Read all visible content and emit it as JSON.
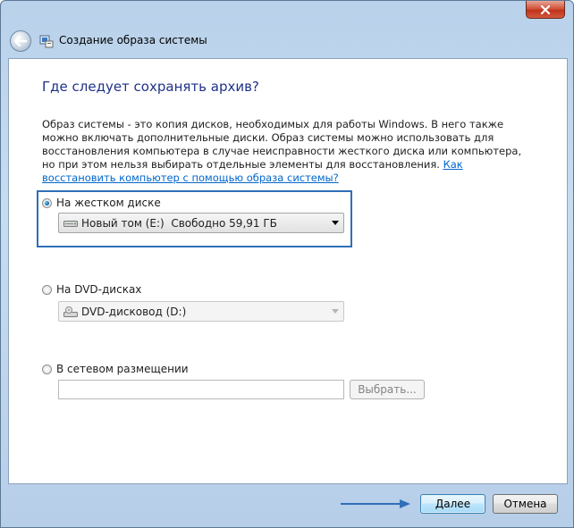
{
  "window": {
    "title": "Создание образа системы",
    "close_icon": "close-icon",
    "back_icon": "back-arrow-icon"
  },
  "main": {
    "heading": "Где следует сохранять архив?",
    "description": "Образ системы - это копия дисков, необходимых для работы Windows. В него также можно включать дополнительные диски. Образ системы можно использовать для восстановления компьютера в случае неисправности жесткого диска или компьютера, но при этом нельзя выбирать отдельные элементы для восстановления.",
    "help_link": "Как восстановить компьютер с помощью образа системы?"
  },
  "options": {
    "hard_disk": {
      "label": "На жестком диске",
      "selected": true,
      "select_value": "Новый том (E:)  Свободно 59,91 ГБ"
    },
    "dvd": {
      "label": "На DVD-дисках",
      "selected": false,
      "select_value": "DVD-дисковод (D:)"
    },
    "network": {
      "label": "В сетевом размещении",
      "selected": false,
      "input_value": "",
      "browse_label": "Выбрать..."
    }
  },
  "footer": {
    "next_label": "Далее",
    "cancel_label": "Отмена"
  },
  "colors": {
    "heading": "#1e3287",
    "link": "#0066cc",
    "highlight": "#2f6fb8"
  }
}
